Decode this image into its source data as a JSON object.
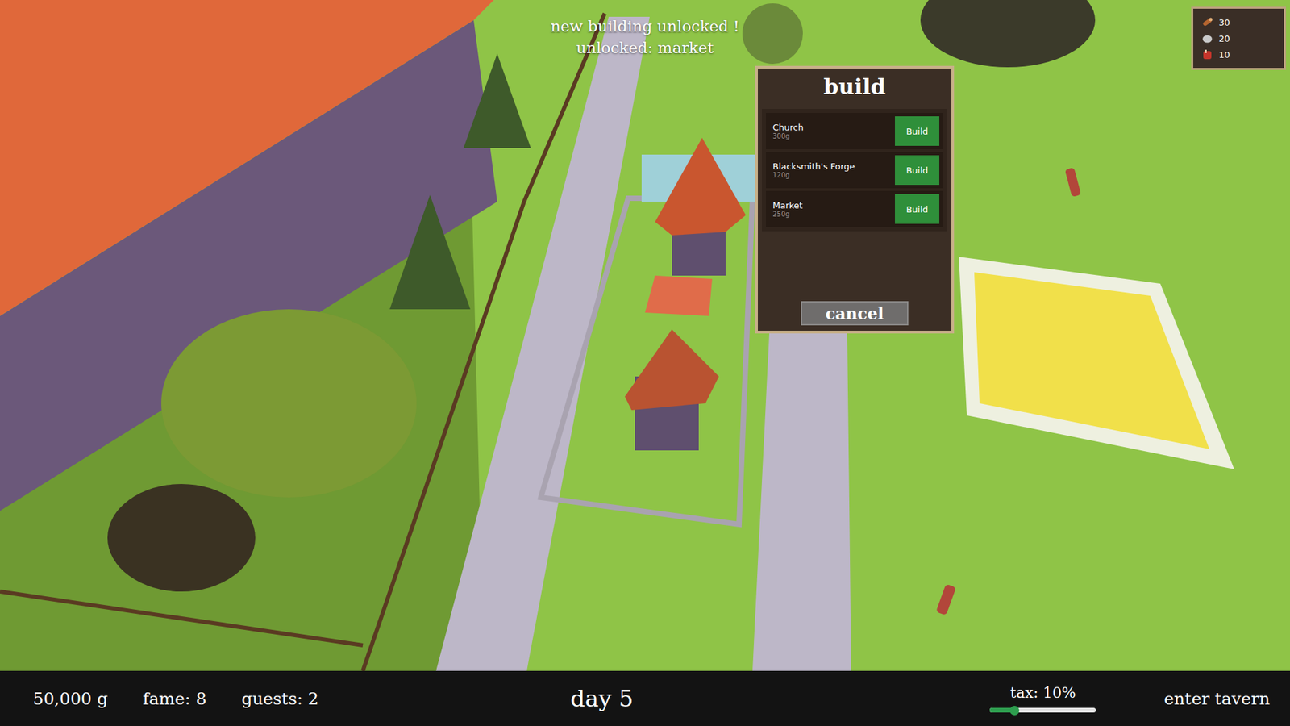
{
  "notification": {
    "lines": [
      "new building unlocked !",
      "unlocked: market"
    ]
  },
  "build_panel": {
    "title": "build",
    "items": [
      {
        "name": "Church",
        "price": "300g",
        "button": "Build"
      },
      {
        "name": "Blacksmith's Forge",
        "price": "120g",
        "button": "Build"
      },
      {
        "name": "Market",
        "price": "250g",
        "button": "Build"
      }
    ],
    "cancel": "cancel"
  },
  "resources": [
    {
      "kind": "wood",
      "amount": "30"
    },
    {
      "kind": "stone",
      "amount": "20"
    },
    {
      "kind": "meat",
      "amount": "10"
    }
  ],
  "status_bar": {
    "gold": "50,000 g",
    "fame": "fame: 8",
    "guests": "guests: 2",
    "day": "day 5",
    "tax": {
      "label": "tax: 10%",
      "level": 0.23
    },
    "enter": "enter tavern"
  }
}
